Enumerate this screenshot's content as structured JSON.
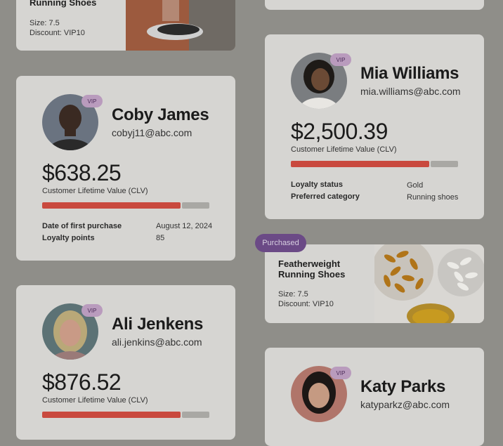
{
  "top_left_card": {
    "title": "Running Shoes",
    "size": "Size: 7.5",
    "discount": "Discount: VIP10"
  },
  "customers": [
    {
      "name": "Coby James",
      "email": "cobyj11@abc.com",
      "badge": "VIP",
      "clv": "$638.25",
      "clv_label": "Customer Lifetime Value (CLV)",
      "clv_progress": 0.84,
      "fields": [
        {
          "label": "Date of first purchase",
          "value": "August 12, 2024"
        },
        {
          "label": "Loyalty points",
          "value": "85"
        }
      ]
    },
    {
      "name": "Mia Williams",
      "email": "mia.williams@abc.com",
      "badge": "VIP",
      "clv": "$2,500.39",
      "clv_label": "Customer Lifetime Value (CLV)",
      "clv_progress": 0.84,
      "fields": [
        {
          "label": "Loyalty status",
          "value": "Gold"
        },
        {
          "label": "Preferred category",
          "value": "Running shoes"
        }
      ]
    },
    {
      "name": "Ali Jenkens",
      "email": "ali.jenkins@abc.com",
      "badge": "VIP",
      "clv": "$876.52",
      "clv_label": "Customer Lifetime Value (CLV)",
      "clv_progress": 0.84
    },
    {
      "name": "Katy Parks",
      "email": "katyparkz@abc.com",
      "badge": "VIP"
    }
  ],
  "product_card": {
    "status": "Purchased",
    "title_line1": "Featherweight",
    "title_line2": "Running Shoes",
    "size": "Size: 7.5",
    "discount": "Discount: VIP10"
  },
  "icons": [
    "shoe-photo",
    "capsule-photo"
  ]
}
